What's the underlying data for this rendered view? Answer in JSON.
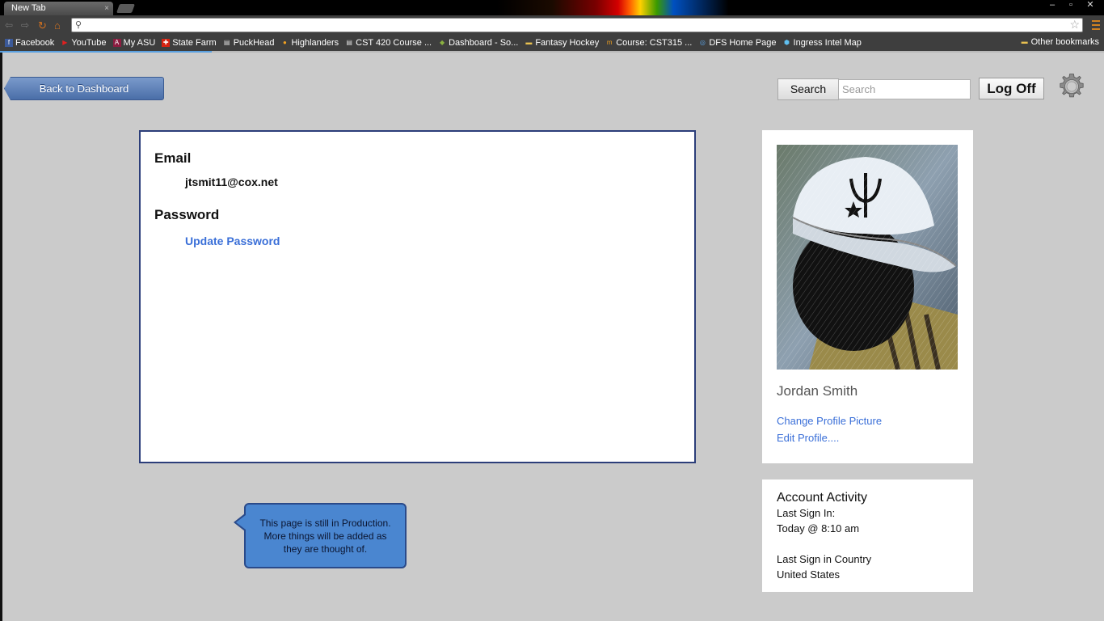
{
  "browser": {
    "tab_title": "New Tab",
    "tab_close": "×",
    "window_controls": [
      "–",
      "▫",
      "✕"
    ],
    "bookmarks": [
      {
        "label": "Facebook",
        "icon": "f"
      },
      {
        "label": "YouTube",
        "icon": "▶"
      },
      {
        "label": "My ASU",
        "icon": "A"
      },
      {
        "label": "State Farm",
        "icon": "✚"
      },
      {
        "label": "PuckHead",
        "icon": "▤"
      },
      {
        "label": "Highlanders",
        "icon": "●"
      },
      {
        "label": "CST 420 Course ...",
        "icon": "▤"
      },
      {
        "label": "Dashboard - So...",
        "icon": "◆"
      },
      {
        "label": "Fantasy Hockey",
        "icon": "▬"
      },
      {
        "label": "Course: CST315 ...",
        "icon": "m"
      },
      {
        "label": "DFS Home Page",
        "icon": "◎"
      },
      {
        "label": "Ingress Intel Map",
        "icon": "⬢"
      }
    ],
    "other_bookmarks": "Other bookmarks"
  },
  "header": {
    "back_label": "Back to Dashboard",
    "search_button": "Search",
    "search_placeholder": "Search",
    "logoff_label": "Log Off"
  },
  "account": {
    "email_title": "Email",
    "email_value": "jtsmit11@cox.net",
    "password_title": "Password",
    "update_password": "Update Password"
  },
  "profile": {
    "name": "Jordan Smith",
    "change_picture": "Change Profile Picture",
    "edit_profile": "Edit Profile...."
  },
  "activity": {
    "title": "Account Activity",
    "last_sign_in_label": "Last Sign In:",
    "last_sign_in_value": "Today @ 8:10 am",
    "last_country_label": "Last Sign in Country",
    "last_country_value": "United States"
  },
  "notice": {
    "line1": "This page is still in Production.",
    "line2": "More things will be added as",
    "line3": "they are thought of."
  },
  "colors": {
    "accent_blue": "#3a6fd8",
    "panel_border": "#2c3e7a",
    "callout_fill": "#4a86d0"
  }
}
